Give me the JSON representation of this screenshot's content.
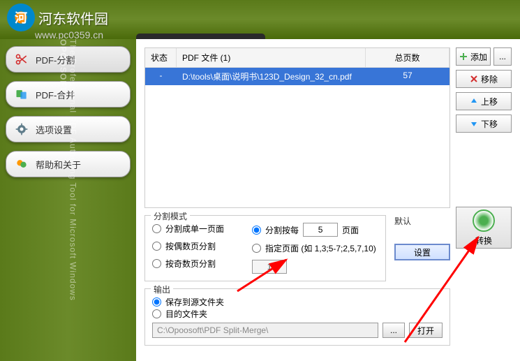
{
  "watermark": {
    "name": "河东软件园",
    "url": "www.pc0359.cn"
  },
  "sidebar": {
    "items": [
      {
        "label": "PDF-分割",
        "icon": "scissors"
      },
      {
        "label": "PDF-合并",
        "icon": "merge"
      },
      {
        "label": "选项设置",
        "icon": "gear"
      },
      {
        "label": "帮助和关于",
        "icon": "help"
      }
    ],
    "brand": "OPOOSOFT",
    "tagline": "The Professional PDF Authoring Tool for Microsoft Windows"
  },
  "table": {
    "headers": {
      "status": "状态",
      "file": "PDF 文件 (1)",
      "pages": "总页数"
    },
    "rows": [
      {
        "status": "-",
        "file": "D:\\tools\\桌面\\说明书\\123D_Design_32_cn.pdf",
        "pages": "57"
      }
    ]
  },
  "actions": {
    "add": "添加",
    "browse": "...",
    "remove": "移除",
    "moveup": "上移",
    "movedown": "下移",
    "convert": "转换"
  },
  "splitMode": {
    "title": "分割模式",
    "singlePage": "分割成单一页面",
    "evenPages": "按偶数页分割",
    "oddPages": "按奇数页分割",
    "splitEvery": "分割按每",
    "pagesUnit": "页面",
    "everyValue": "5",
    "specifyPages": "指定页面 (如 1,3;5-7;2,5,7,10)",
    "specifyValue": "1"
  },
  "default": {
    "label": "默认",
    "settings": "设置"
  },
  "output": {
    "title": "输出",
    "saveToSource": "保存到源文件夹",
    "targetFolder": "目的文件夹",
    "path": "C:\\Opoosoft\\PDF Split-Merge\\",
    "browse": "...",
    "open": "打开"
  }
}
